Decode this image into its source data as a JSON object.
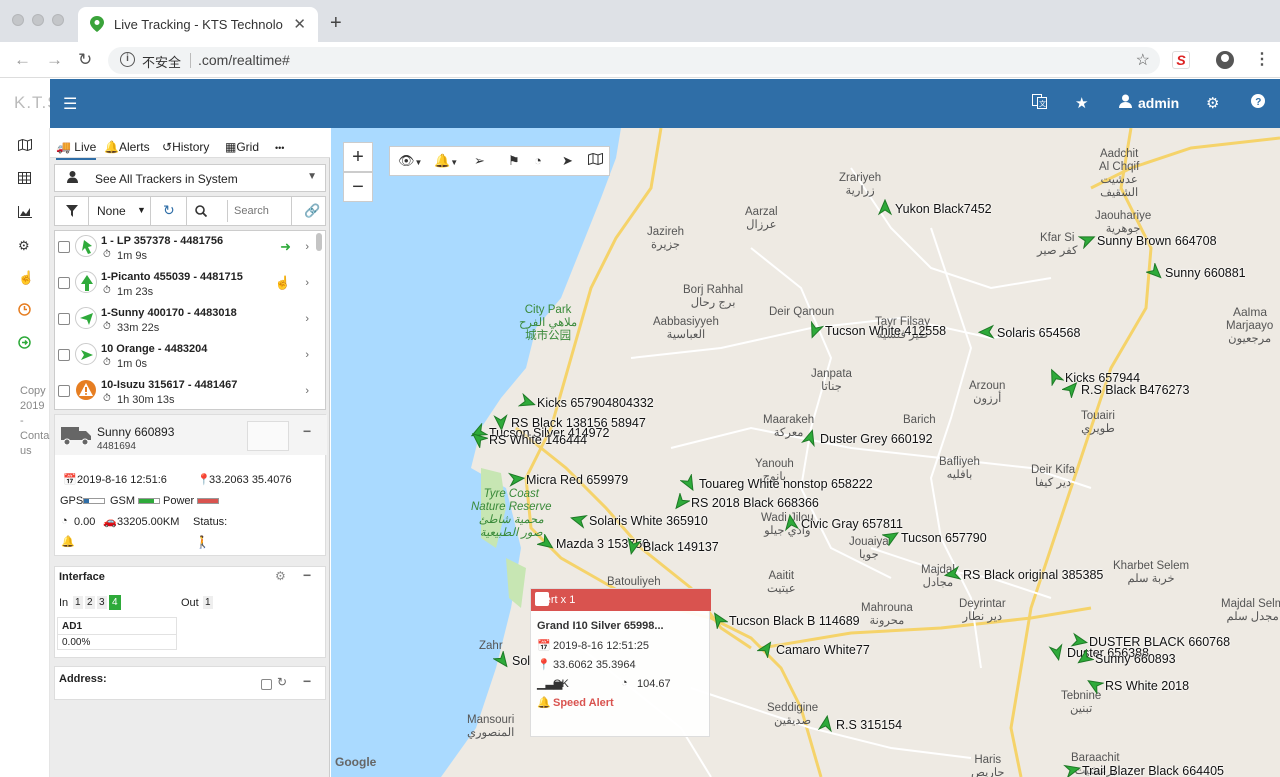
{
  "browser": {
    "tab_title": "Live Tracking - KTS Technolo",
    "insecure_label": "不安全",
    "url": "‌.com/realtime#"
  },
  "header": {
    "logo_text": "K.T.S",
    "admin_label": "admin"
  },
  "rail": {
    "copyright": "Copy 2019 - Conta us"
  },
  "panel": {
    "tabs": [
      {
        "label": "Live"
      },
      {
        "label": "Alerts"
      },
      {
        "label": "History"
      },
      {
        "label": "Grid"
      },
      {
        "label": "•••"
      }
    ],
    "tracker_select": "See All Trackers in System",
    "filter_value": "None",
    "search_placeholder": "Search",
    "trackers": [
      {
        "name": "1 - LP 357378 - 4481756",
        "time": "1m 9s",
        "color": "#2eaa3a"
      },
      {
        "name": "1-Picanto 455039 - 4481715",
        "time": "1m 23s",
        "color": "#2eaa3a"
      },
      {
        "name": "1-Sunny 400170 - 4483018",
        "time": "33m 22s",
        "color": "#2eaa3a"
      },
      {
        "name": "10 Orange - 4483204",
        "time": "1m 0s",
        "color": "#2eaa3a"
      },
      {
        "name": "10-Isuzu 315617 - 4481467",
        "time": "1h 30m 13s",
        "color": "#e67e22"
      }
    ],
    "detail": {
      "name": "Sunny 660893",
      "id": "4481694",
      "datetime": "2019-8-16 12:51:6",
      "coords": "33.2063 35.4076",
      "gps_label": "GPS",
      "gsm_label": "GSM",
      "power_label": "Power",
      "speed": "0.00",
      "odometer": "33205.00KM",
      "status_label": "Status:"
    },
    "interface": {
      "title": "Interface",
      "in_label": "In",
      "inputs": [
        "1",
        "2",
        "3",
        "4"
      ],
      "out_label": "Out",
      "outputs": [
        "1"
      ],
      "ad_label": "AD1",
      "ad_value": "0.00%"
    },
    "address_label": "Address:"
  },
  "map": {
    "google": "Google",
    "vehicles": [
      {
        "label": "Yukon Black7452"
      },
      {
        "label": "Sunny Brown 664708"
      },
      {
        "label": "Sunny 660881"
      },
      {
        "label": "Tucson White 412558"
      },
      {
        "label": "Solaris 654568"
      },
      {
        "label": "Kicks 657944"
      },
      {
        "label": "R.S Black B476273"
      },
      {
        "label": "Kicks 657904804332"
      },
      {
        "label": "RS Black 138156 58947"
      },
      {
        "label": "Tucson Silver 414972"
      },
      {
        "label": "RS White 146444"
      },
      {
        "label": "Duster Grey 660192"
      },
      {
        "label": "Micra Red 659979"
      },
      {
        "label": "Touareg White nonstop 658222"
      },
      {
        "label": "RS 2018 Black 668366"
      },
      {
        "label": "Solaris White 365910"
      },
      {
        "label": "Civic Gray 657811"
      },
      {
        "label": "Tucson 657790"
      },
      {
        "label": "Mazda 3 153750"
      },
      {
        "label": "Black 149137"
      },
      {
        "label": "RS Black original 385385"
      },
      {
        "label": "Tucson Black B 114689"
      },
      {
        "label": "Camaro White77"
      },
      {
        "label": "DUSTER BLACK 660768"
      },
      {
        "label": "Duster 656388"
      },
      {
        "label": "Sunny 660893"
      },
      {
        "label": "RS White 2018"
      },
      {
        "label": "R.S 315154"
      },
      {
        "label": "Trail Blazer Black 664405"
      },
      {
        "label": "Sol"
      }
    ],
    "places": [
      {
        "name": "Zrariyeh\nزرارية"
      },
      {
        "name": "Aadchit\nAl Chqif\nعدشيت\nالشقيف"
      },
      {
        "name": "Aarzal\nعرزال"
      },
      {
        "name": "Jazireh\nجزيرة"
      },
      {
        "name": "Jaouhariye\nجوهرية"
      },
      {
        "name": "Kfar Si\nكفر صير"
      },
      {
        "name": "Borj Rahhal\nبرج رحال"
      },
      {
        "name": "Tayr Filsay\nطير فلسيه"
      },
      {
        "name": "Aabbasiyyeh\nالعباسية"
      },
      {
        "name": "Deir Qanoun"
      },
      {
        "name": "City Park\nملاهي الفرح\n城市公园"
      },
      {
        "name": "Janpata\nجناتا"
      },
      {
        "name": "Arzoun\nأرزون"
      },
      {
        "name": "Maarakeh\nمعركة"
      },
      {
        "name": "Barich"
      },
      {
        "name": "Touairi\nطويري"
      },
      {
        "name": "Yanouh\nيانوح"
      },
      {
        "name": "Bafliyeh\nبافليه"
      },
      {
        "name": "Deir Kifa\nدير كيفا"
      },
      {
        "name": "Tyre Coast\nNature Reserve\nمحمية شاطئ\nصور الطبيعية"
      },
      {
        "name": "Wadi Jilou\nوادي جيلو"
      },
      {
        "name": "Jouaiya\nجويا"
      },
      {
        "name": "Aaitit\nعيتيت"
      },
      {
        "name": "Majdal\nمجادل"
      },
      {
        "name": "Kharbet Selem\nخربة سلم"
      },
      {
        "name": "Majdal Selm\nمجدل سلم"
      },
      {
        "name": "Batouliyeh"
      },
      {
        "name": "Deyrintar\nدير نطار"
      },
      {
        "name": "Mahrouna\nمحرونة"
      },
      {
        "name": "Tebnine\nتبنين"
      },
      {
        "name": "Seddigine\nصديقين"
      },
      {
        "name": "Mansouri\nالمنصوري"
      },
      {
        "name": "Haris\nحاريص"
      },
      {
        "name": "Baraachit\nبرعشيت"
      },
      {
        "name": "Zahr"
      },
      {
        "name": "Marjaayo\nمرجعيون"
      },
      {
        "name": "Aalma"
      }
    ],
    "alert": {
      "title": "Alert x 1",
      "vehicle": "Grand I10 Silver 65998...",
      "datetime": "2019-8-16 12:51:25",
      "coords": "33.6062 35.3964",
      "signal": "OK",
      "speed": "104.67",
      "type": "Speed Alert"
    }
  }
}
